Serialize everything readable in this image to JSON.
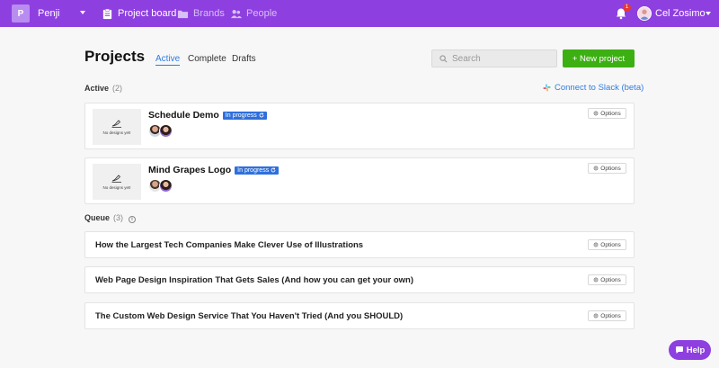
{
  "nav": {
    "workspace_initial": "P",
    "workspace_name": "Penji",
    "items": [
      {
        "label": "Project board",
        "icon": "clipboard-icon"
      },
      {
        "label": "Brands",
        "icon": "folder-icon"
      },
      {
        "label": "People",
        "icon": "people-icon"
      }
    ],
    "notification_count": "1",
    "user_name": "Cel Zosimo",
    "background": "#8e3fe0"
  },
  "header": {
    "title": "Projects",
    "tabs": [
      {
        "label": "Active",
        "selected": true
      },
      {
        "label": "Complete",
        "selected": false
      },
      {
        "label": "Drafts",
        "selected": false
      }
    ],
    "search_placeholder": "Search",
    "new_project_label": "+ New project"
  },
  "active": {
    "label": "Active",
    "count": "(2)",
    "slack_link": "Connect to Slack (beta)",
    "projects": [
      {
        "thumb_text": "No designs yet!",
        "title": "Schedule Demo",
        "status": "In progress",
        "options": "Options"
      },
      {
        "thumb_text": "No designs yet!",
        "title": "Mind Grapes Logo",
        "status": "In progress",
        "options": "Options"
      }
    ]
  },
  "queue": {
    "label": "Queue",
    "count": "(3)",
    "projects": [
      {
        "title": "How the Largest Tech Companies Make Clever Use of Illustrations",
        "options": "Options"
      },
      {
        "title": "Web Page Design Inspiration That Gets Sales (And how you can get your own)",
        "options": "Options"
      },
      {
        "title": "The Custom Web Design Service That You Haven't Tried (And you SHOULD)",
        "options": "Options"
      }
    ]
  },
  "help_label": "Help",
  "colors": {
    "accent": "#8e3fe0",
    "link": "#2f7de1",
    "new_button": "#3cb012",
    "status_badge": "#2f6fdc"
  }
}
